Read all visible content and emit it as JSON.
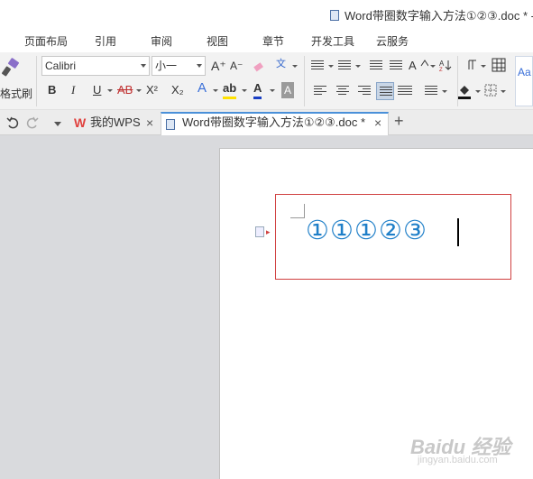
{
  "window": {
    "title": "Word带圈数字输入方法①②③.doc * -"
  },
  "menu": [
    "页面布局",
    "引用",
    "审阅",
    "视图",
    "章节",
    "开发工具",
    "云服务"
  ],
  "ribbon": {
    "format_painter_label": "格式刷",
    "font_name": "Calibri",
    "font_size": "小一",
    "grow_font": "A⁺",
    "shrink_font": "A⁻",
    "bold": "B",
    "italic": "I",
    "underline": "U",
    "strikethrough": "AB",
    "superscript": "X²",
    "subscript": "X₂",
    "text_effect": "A",
    "highlight": "ab",
    "font_color": "A",
    "char_shading": "A",
    "phonetic": "文",
    "style_preview": "Aa"
  },
  "tabs": [
    {
      "label": "我的WPS",
      "close": "×"
    },
    {
      "label": "Word带圈数字输入方法①②③.doc *",
      "close": "×"
    }
  ],
  "new_tab": "+",
  "document": {
    "text": "①①①②③"
  },
  "watermark": {
    "brand": "Baidu 经验",
    "url": "jingyan.baidu.com"
  },
  "colors": {
    "accent": "#4a90d9",
    "circled_digits": "#1f7fc8",
    "selection_box": "#d04040",
    "wps_red": "#e0403d"
  }
}
